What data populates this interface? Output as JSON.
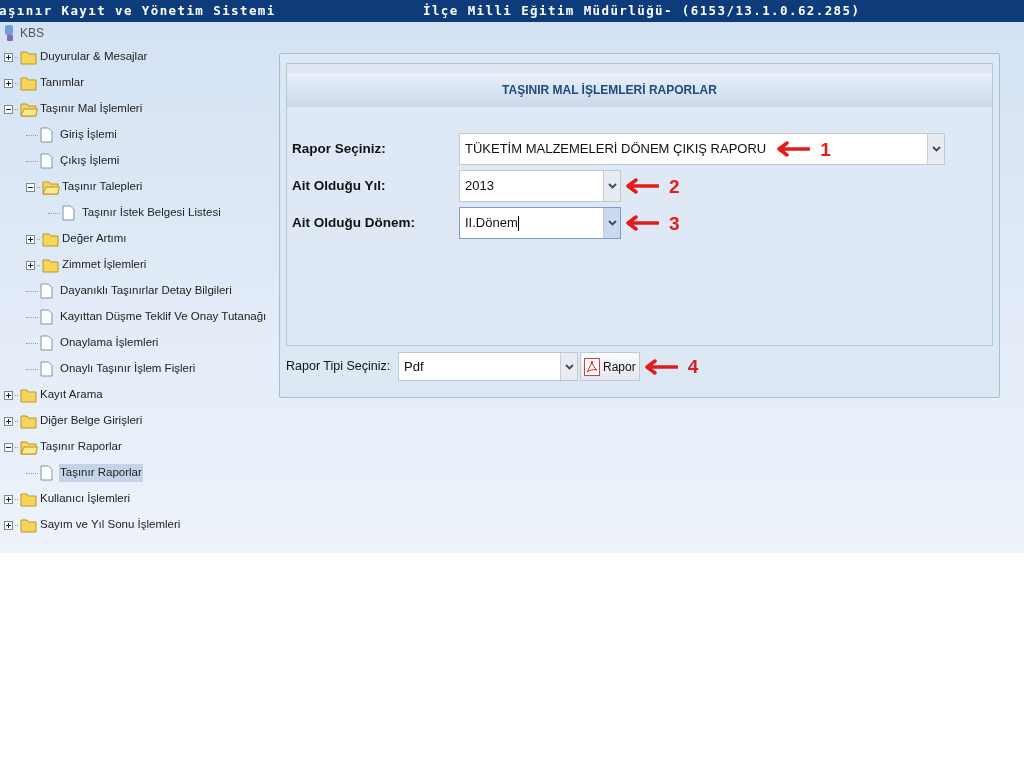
{
  "title_bar": {
    "app_title": "aşınır Kayıt ve Yönetim Sistemi",
    "org_title": "İlçe Milli Eğitim Müdürlüğü- (6153/13.1.0.62.285)"
  },
  "tree": {
    "root": "KBS",
    "items": [
      {
        "label": "Duyurular & Mesajlar",
        "kind": "folder",
        "expanded": false
      },
      {
        "label": "Tanımlar",
        "kind": "folder",
        "expanded": false
      },
      {
        "label": "Taşınır Mal İşlemleri",
        "kind": "folder",
        "expanded": true,
        "children": [
          {
            "label": "Giriş İşlemi",
            "kind": "leaf",
            "selected": false
          },
          {
            "label": "Çıkış İşlemi",
            "kind": "leaf",
            "selected": false
          },
          {
            "label": "Taşınır Talepleri",
            "kind": "folder",
            "expanded": true,
            "children": [
              {
                "label": "Taşınır İstek Belgesi Listesi",
                "kind": "leaf",
                "selected": false
              }
            ]
          },
          {
            "label": "Değer Artımı",
            "kind": "folder",
            "expanded": false
          },
          {
            "label": "Zimmet İşlemleri",
            "kind": "folder",
            "expanded": false
          },
          {
            "label": "Dayanıklı Taşınırlar Detay Bilgileri",
            "kind": "leaf",
            "selected": false
          },
          {
            "label": "Kayıttan Düşme Teklif Ve Onay Tutanağı",
            "kind": "leaf",
            "selected": false
          },
          {
            "label": "Onaylama İşlemleri",
            "kind": "leaf",
            "selected": false
          },
          {
            "label": "Onaylı Taşınır İşlem Fişleri",
            "kind": "leaf",
            "selected": false
          }
        ]
      },
      {
        "label": "Kayıt Arama",
        "kind": "folder",
        "expanded": false
      },
      {
        "label": "Diğer Belge Girişleri",
        "kind": "folder",
        "expanded": false
      },
      {
        "label": "Taşınır Raporlar",
        "kind": "folder",
        "expanded": true,
        "children": [
          {
            "label": "Taşınır Raporlar",
            "kind": "leaf",
            "selected": true
          }
        ]
      },
      {
        "label": "Kullanıcı İşlemleri",
        "kind": "folder",
        "expanded": false
      },
      {
        "label": "Sayım ve Yıl Sonu İşlemleri",
        "kind": "folder",
        "expanded": false
      }
    ]
  },
  "panel": {
    "title": "TAŞINIR MAL İŞLEMLERİ RAPORLAR",
    "fields": [
      {
        "label": "Rapor Seçiniz:",
        "value": "TÜKETİM MALZEMELERİ DÖNEM ÇIKIŞ RAPORU",
        "focused": false,
        "callout": "1"
      },
      {
        "label": "Ait Olduğu Yıl:",
        "value": "2013",
        "focused": false,
        "callout": "2"
      },
      {
        "label": "Ait Olduğu Dönem:",
        "value": "II.Dönem",
        "focused": true,
        "callout": "3"
      }
    ],
    "report_type": {
      "label": "Rapor Tipi Seçiniz:",
      "value": "Pdf"
    },
    "report_button": {
      "label": "Rapor",
      "callout": "4"
    }
  }
}
